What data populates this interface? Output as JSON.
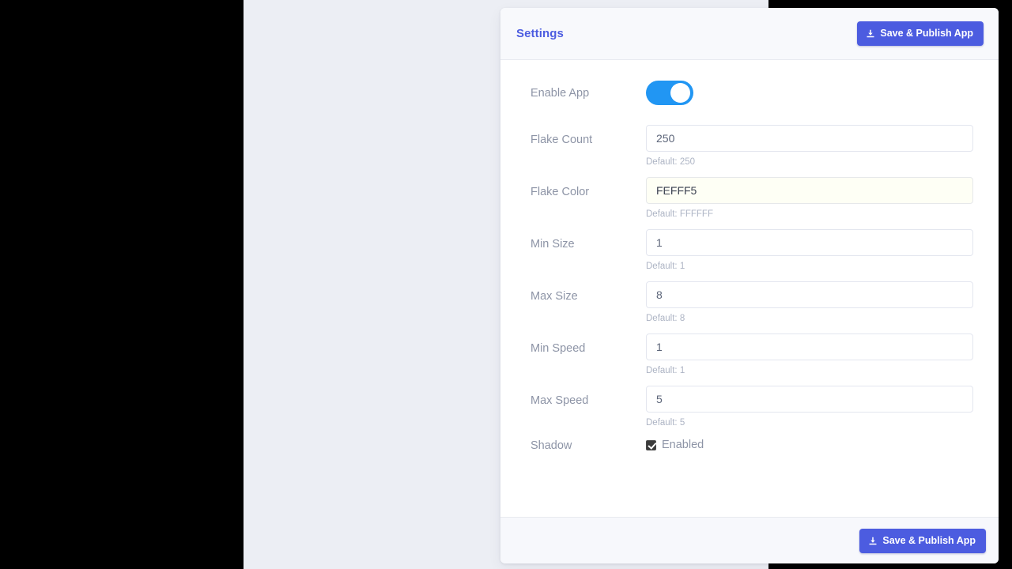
{
  "header": {
    "title": "Settings",
    "save_button": {
      "label": "Save & Publish App",
      "icon": "download-icon"
    }
  },
  "form": {
    "rows": [
      {
        "key": "enable_app",
        "label": "Enable App",
        "type": "toggle",
        "value": "on"
      },
      {
        "key": "flake_count",
        "label": "Flake Count",
        "type": "text",
        "value": "250",
        "help": "Default: 250"
      },
      {
        "key": "flake_color",
        "label": "Flake Color",
        "type": "text",
        "value": "FEFFF5",
        "help": "Default: FFFFFF"
      },
      {
        "key": "min_size",
        "label": "Min Size",
        "type": "text",
        "value": "1",
        "help": "Default: 1"
      },
      {
        "key": "max_size",
        "label": "Max Size",
        "type": "text",
        "value": "8",
        "help": "Default: 8"
      },
      {
        "key": "min_speed",
        "label": "Min Speed",
        "type": "text",
        "value": "1",
        "help": "Default: 1"
      },
      {
        "key": "max_speed",
        "label": "Max Speed",
        "type": "text",
        "value": "5",
        "help": "Default: 5"
      },
      {
        "key": "shadow",
        "label": "Shadow",
        "type": "checkbox",
        "checkbox_label": "Enabled",
        "checked": "true"
      }
    ]
  },
  "footer": {
    "save_button": {
      "label": "Save & Publish App",
      "icon": "download-icon"
    }
  },
  "colors": {
    "accent": "#4C5CE0",
    "toggle_on": "#2196F3",
    "label_text": "#8D94A6",
    "help_text": "#ADB4C4",
    "input_border": "#E3E6EF",
    "color_field_bg": "#FEFFF5",
    "card_bg": "#FFFFFF",
    "header_bg": "#F8F9FC",
    "footer_bg": "#F7F8FC",
    "page_bg": "#ECEEF4",
    "letterbox": "#000000"
  }
}
